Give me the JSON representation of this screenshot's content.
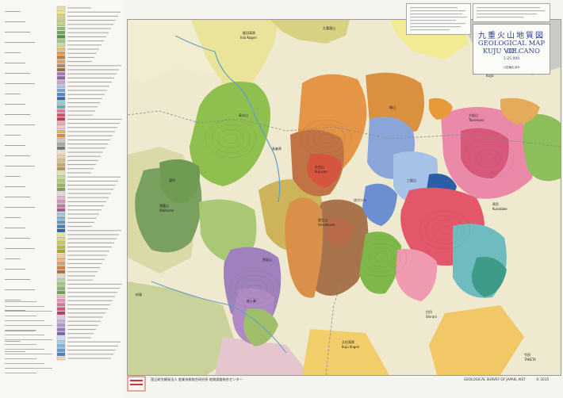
{
  "map": {
    "title_jp": "九重火山地質図",
    "title_en_line1": "GEOLOGICAL MAP OF",
    "title_en_line2": "KUJU VOLCANO",
    "scale": "1:25,000",
    "authors": "川辺禎久ほか"
  },
  "footer": {
    "left_publisher": "国立研究開発法人 産業技術総合研究所 地質調査総合センター",
    "right_publisher": "GEOLOGICAL SURVEY OF JAPAN, AIST",
    "year": "© 2015"
  },
  "places": [
    {
      "id": "p1",
      "text": "飯田高原"
    },
    {
      "id": "p2",
      "text": "Iida Kogen"
    },
    {
      "id": "p3",
      "text": "九重連山"
    },
    {
      "id": "p4",
      "text": "大船山"
    },
    {
      "id": "p5",
      "text": "Taisenzan"
    },
    {
      "id": "p6",
      "text": "久住山"
    },
    {
      "id": "p7",
      "text": "Kujusan"
    },
    {
      "id": "p8",
      "text": "坊ガツル"
    },
    {
      "id": "p9",
      "text": "長者原"
    },
    {
      "id": "p10",
      "text": "黒岳"
    },
    {
      "id": "p11",
      "text": "Kurodake"
    },
    {
      "id": "p12",
      "text": "久住高原"
    },
    {
      "id": "p13",
      "text": "Kuju Kogen"
    },
    {
      "id": "p14",
      "text": "くじゅう"
    },
    {
      "id": "p15",
      "text": "KUJU"
    },
    {
      "id": "p16",
      "text": "玖珠"
    },
    {
      "id": "p17",
      "text": "湯坪"
    },
    {
      "id": "p18",
      "text": "三股山"
    },
    {
      "id": "p19",
      "text": "星生山"
    },
    {
      "id": "p20",
      "text": "Hosshozan"
    },
    {
      "id": "p21",
      "text": "泉水山"
    },
    {
      "id": "p22",
      "text": "涌蓋山"
    },
    {
      "id": "p23",
      "text": "Waitasan"
    },
    {
      "id": "p24",
      "text": "城山"
    },
    {
      "id": "p25",
      "text": "扇ヶ鼻"
    },
    {
      "id": "p26",
      "text": "黒岩山"
    },
    {
      "id": "p27",
      "text": "竹田"
    },
    {
      "id": "p28",
      "text": "TAKETA"
    },
    {
      "id": "p29",
      "text": "白丹"
    },
    {
      "id": "p30",
      "text": "Shirani"
    }
  ],
  "legend": {
    "swatch_colors": [
      "#e8e2b0",
      "#f0e98a",
      "#d9d36e",
      "#c9c98d",
      "#bcd38a",
      "#8fbf6a",
      "#6fa55a",
      "#5a8f4e",
      "#a2c77a",
      "#c6dca2",
      "#e8c07a",
      "#e39a4a",
      "#c97a34",
      "#d4a66b",
      "#b88a5a",
      "#9d6b4a",
      "#a47ab5",
      "#8a64a6",
      "#c9a6d1",
      "#b2c5e8",
      "#7fa3d9",
      "#5a86c7",
      "#3a66a8",
      "#8fd0d0",
      "#5fb4b4",
      "#e8789a",
      "#d94f6e",
      "#c93a4a",
      "#e9a7b8",
      "#f2c9d2",
      "#e6b16e",
      "#d98c44",
      "#c8c8c8",
      "#a6a6a6",
      "#7a7a7a",
      "#f2e6c6",
      "#e6d4a8",
      "#d9c08a",
      "#c9a870",
      "#b8945c",
      "#e0e8b8",
      "#c8d898",
      "#b0c878",
      "#98b860",
      "#80a848",
      "#f0d8e8",
      "#e0b8d0",
      "#d098b8",
      "#c078a0",
      "#b05888",
      "#a0c8e0",
      "#80b0d0",
      "#6098c0",
      "#4080b0",
      "#2068a0",
      "#e8e8a0",
      "#d8d880",
      "#c8c860",
      "#b8b840",
      "#a8a820",
      "#f5cfa3",
      "#e9b585",
      "#dc9c66",
      "#cf8248",
      "#c2692a",
      "#d6e6c6",
      "#bcd6a6",
      "#a2c686",
      "#88b666",
      "#6ea646",
      "#f1b6c6",
      "#e596ae",
      "#d97696",
      "#cd567e",
      "#c13666",
      "#d9cfe9",
      "#c3b3dd",
      "#ad97d1",
      "#977bc5",
      "#815fb9",
      "#cfe2f2",
      "#a9cbe8",
      "#83b4de",
      "#5d9dd4",
      "#3786ca",
      "#eeddaa"
    ]
  }
}
